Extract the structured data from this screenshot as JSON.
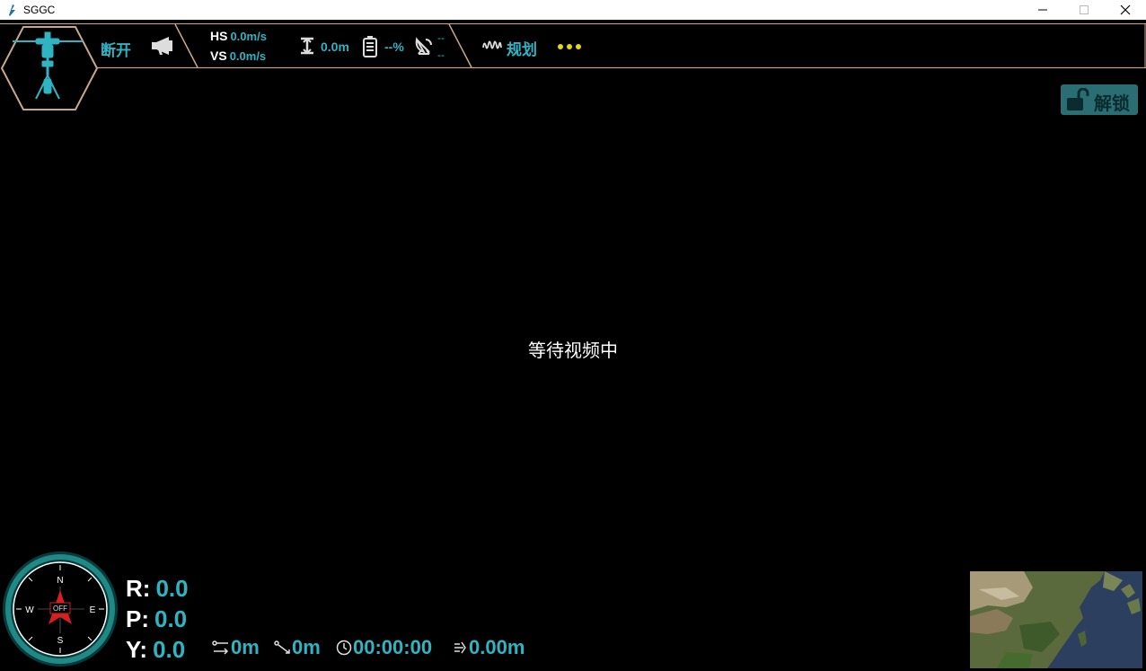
{
  "window": {
    "title": "SGGC",
    "icon": "app-logo-icon",
    "controls": [
      "minimize-icon",
      "maximize-icon",
      "close-icon"
    ]
  },
  "topbar": {
    "connection_status": "断开",
    "hs_label": "HS",
    "hs_value": "0.0m/s",
    "vs_label": "VS",
    "vs_value": "0.0m/s",
    "altitude": "0.0m",
    "battery": "--%",
    "satellite_line1": "--",
    "satellite_line2": "--",
    "plan_label": "规划",
    "more_icon": "more-dots-icon",
    "accent_color": "#2fb4c4",
    "more_color": "#e6d80a"
  },
  "unlock": {
    "label": "解锁"
  },
  "video": {
    "status": "等待视频中"
  },
  "compass": {
    "north": "N",
    "south": "S",
    "east": "E",
    "west": "W",
    "badge": "OFF"
  },
  "attitude": {
    "r_label": "R:",
    "r_value": "0.0",
    "p_label": "P:",
    "p_value": "0.0",
    "y_label": "Y:",
    "y_value": "0.0"
  },
  "stats": {
    "horizontal_distance": "0m",
    "straight_distance": "0m",
    "flight_time": "00:00:00",
    "wind_speed": "0.00m"
  }
}
